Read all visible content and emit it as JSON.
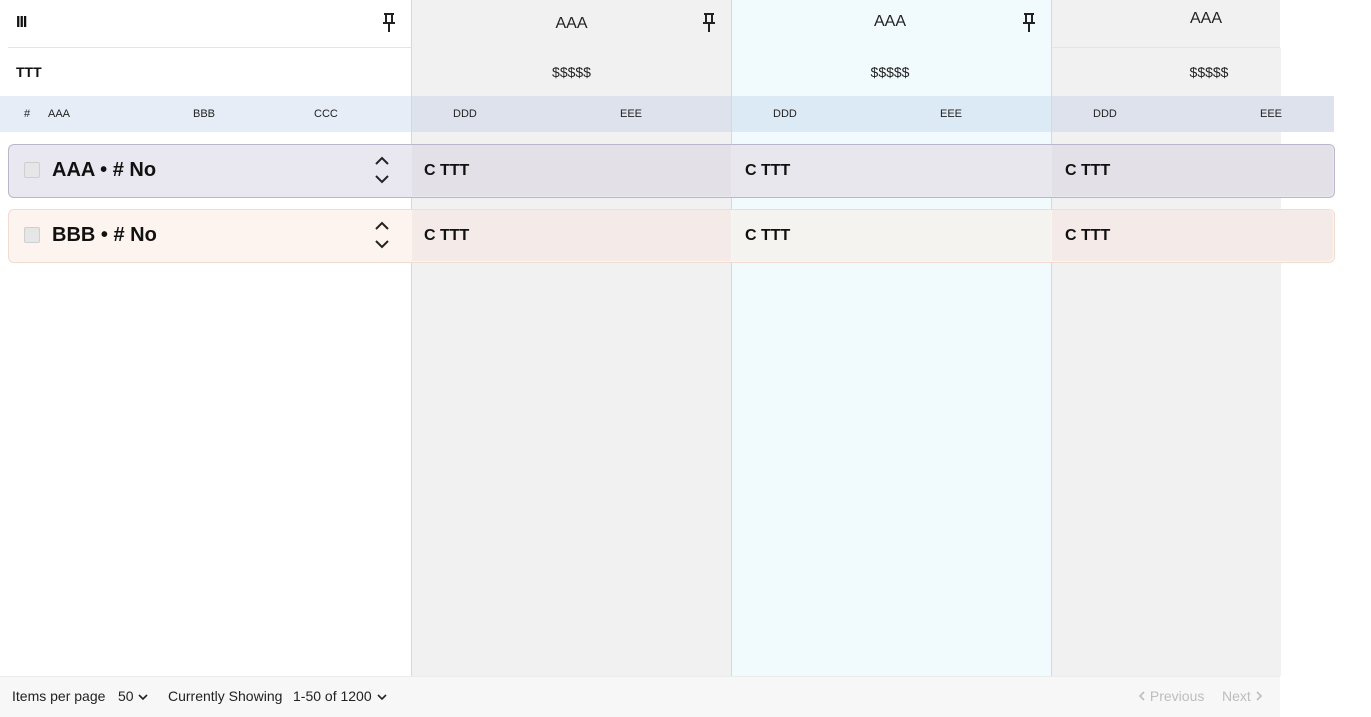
{
  "header": {
    "menu_icon": "column-menu-icon",
    "columns": [
      {
        "title": "AAA",
        "price": "$$$$$"
      },
      {
        "title": "AAA",
        "price": "$$$$$"
      },
      {
        "title": "AAA",
        "price": "$$$$$"
      }
    ],
    "left_label": "TTT"
  },
  "column_headers": {
    "left": [
      "#",
      "AAA",
      "BBB",
      "CCC"
    ],
    "group": [
      "DDD",
      "EEE"
    ]
  },
  "rows": [
    {
      "title": "AAA • #  No",
      "cells": [
        "C TTT",
        "C TTT",
        "C TTT"
      ]
    },
    {
      "title": "BBB • # No",
      "cells": [
        "C TTT",
        "C TTT",
        "C TTT"
      ]
    }
  ],
  "footer": {
    "items_per_page_label": "Items per page",
    "items_per_page_value": "50",
    "showing_label": "Currently Showing",
    "showing_value": "1-50 of 1200",
    "previous_label": "Previous",
    "next_label": "Next"
  }
}
